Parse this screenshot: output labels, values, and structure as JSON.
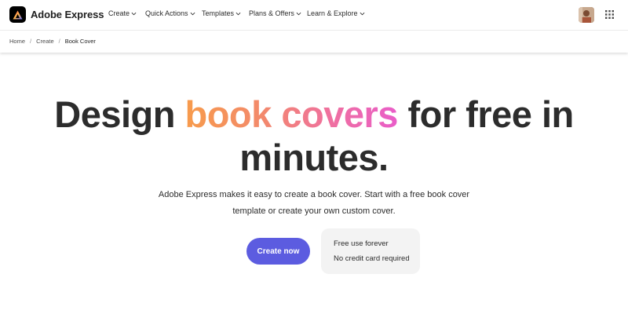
{
  "brand": {
    "name": "Adobe Express"
  },
  "nav": {
    "items": [
      {
        "label": "Create"
      },
      {
        "label": "Quick Actions"
      },
      {
        "label": "Templates"
      },
      {
        "label": "Plans & Offers"
      },
      {
        "label": "Learn & Explore"
      }
    ]
  },
  "header": {
    "avatar_icon": "user-avatar",
    "apps_icon": "grid-icon"
  },
  "breadcrumb": [
    "Home",
    "Create",
    "Book Cover"
  ],
  "hero": {
    "title_before": "Design ",
    "title_highlight": "book covers",
    "title_after": " for free in minutes.",
    "subtitle": "Adobe Express makes it easy to create a book cover. Start with a free book cover template or create your own custom cover."
  },
  "cta": {
    "label": "Create now",
    "color": "#5c5ce0"
  },
  "perks": [
    "Free use forever",
    "No credit card required"
  ],
  "colors": {
    "highlight_start": "#f79b4c",
    "highlight_end": "#e95dc9"
  }
}
